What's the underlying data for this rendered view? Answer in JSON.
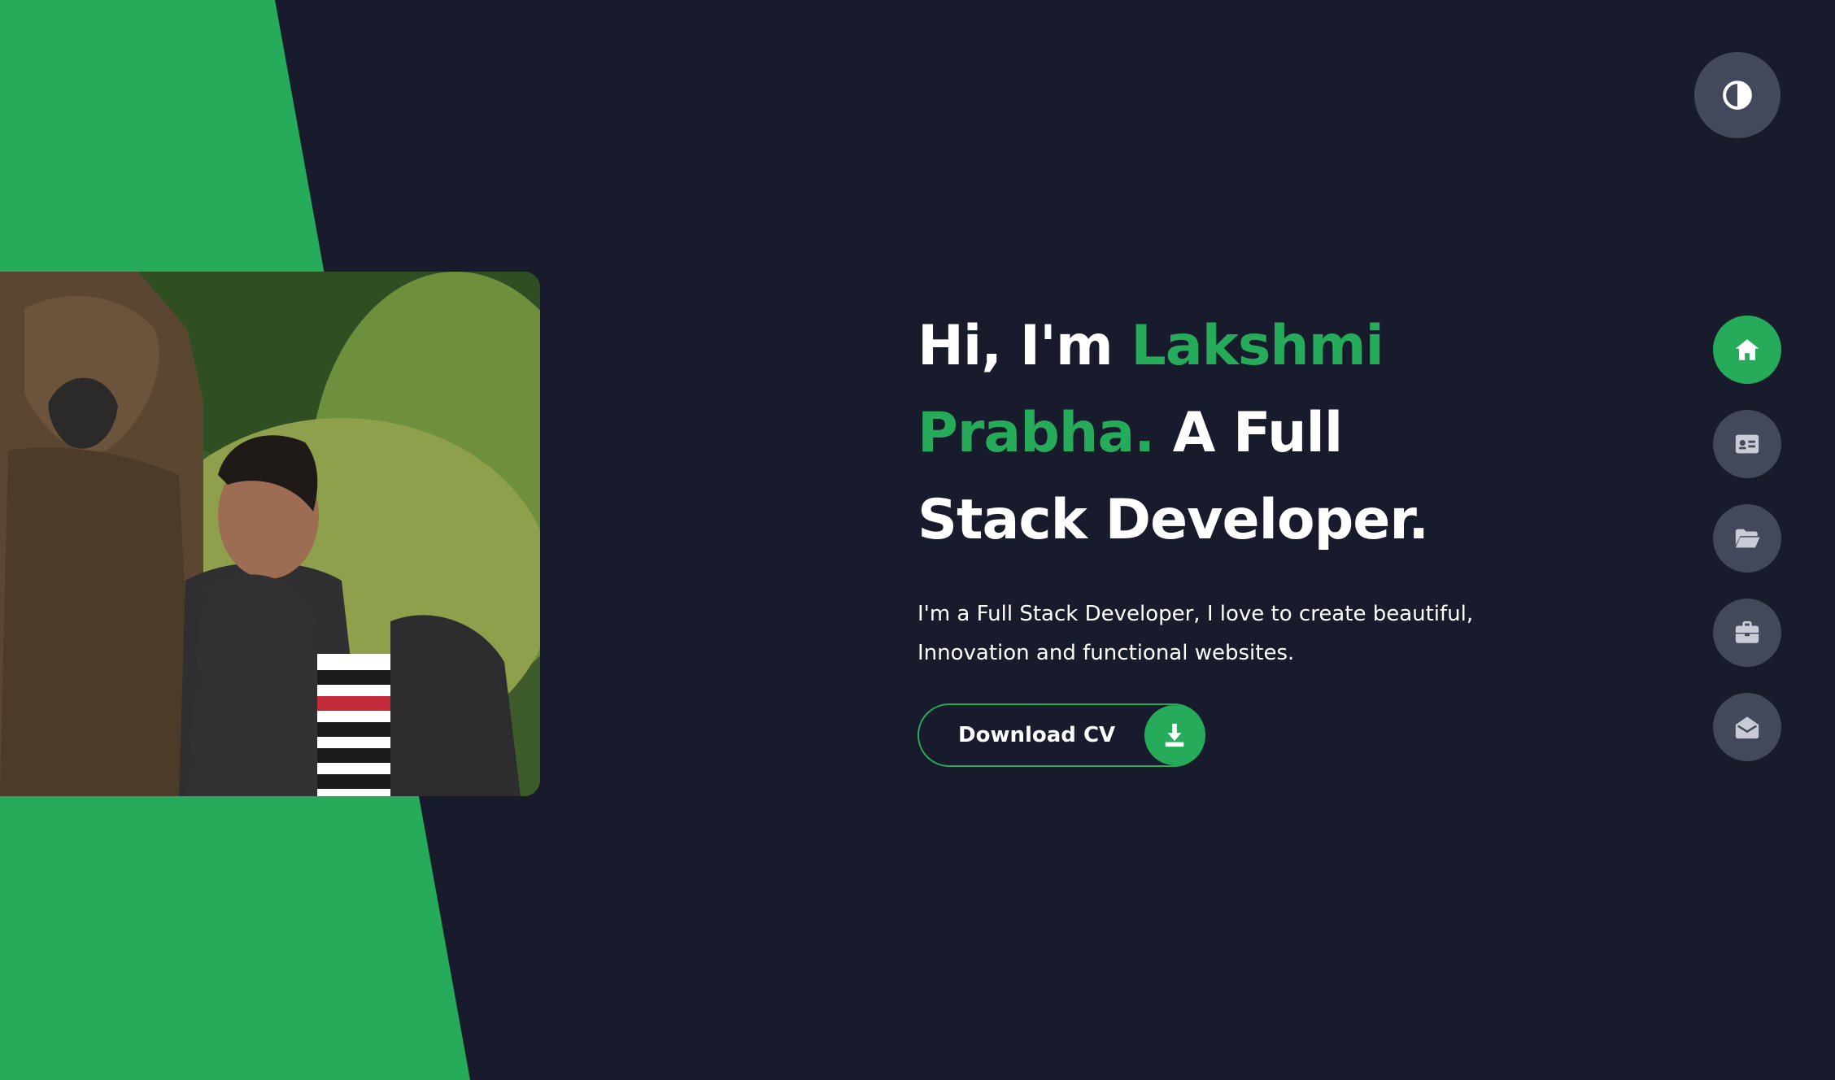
{
  "theme": {
    "background": "#181b2b",
    "accent": "#25ab5a",
    "button_bg": "#43495a",
    "text": "#ffffff"
  },
  "toolbar": {
    "theme_toggle_icon": "contrast-icon"
  },
  "hero": {
    "greeting": "Hi, I'm ",
    "name": "Lakshmi Prabha.",
    "role": " A Full Stack Developer.",
    "description": "I'm a Full Stack Developer, I love to create beautiful, Innovation and functional websites.",
    "cta_label": "Download CV",
    "cta_icon": "download-icon"
  },
  "profile_image": {
    "description_icon": "photo-icon"
  },
  "nav": {
    "items": [
      {
        "icon": "home-icon",
        "active": true
      },
      {
        "icon": "id-card-icon",
        "active": false
      },
      {
        "icon": "folder-open-icon",
        "active": false
      },
      {
        "icon": "briefcase-icon",
        "active": false
      },
      {
        "icon": "envelope-open-icon",
        "active": false
      }
    ]
  }
}
